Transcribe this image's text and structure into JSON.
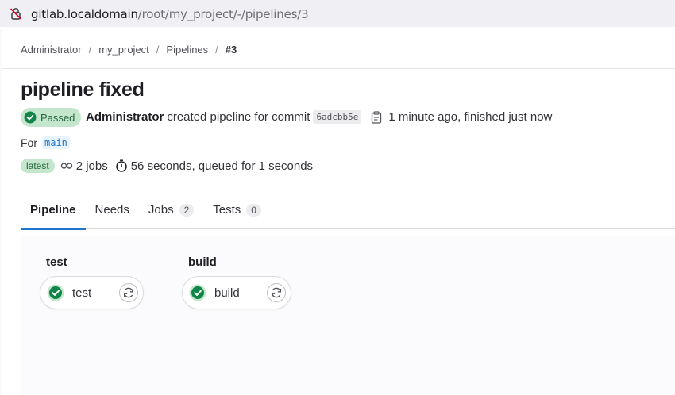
{
  "browser": {
    "url_host": "gitlab.localdomain",
    "url_path": "/root/my_project/-/pipelines/3",
    "lock_icon": "insecure-lock-icon"
  },
  "breadcrumb": [
    "Administrator",
    "my_project",
    "Pipelines",
    "#3"
  ],
  "pipeline": {
    "title": "pipeline fixed",
    "status": "Passed",
    "user": "Administrator",
    "action_text": "created pipeline for commit",
    "commit": "6adcbb5e",
    "time_text": "1 minute ago, finished just now",
    "for_label": "For",
    "branch": "main",
    "latest_badge": "latest",
    "jobs_text": "2 jobs",
    "duration_text": "56 seconds, queued for 1 seconds"
  },
  "tabs": [
    {
      "label": "Pipeline",
      "active": true
    },
    {
      "label": "Needs"
    },
    {
      "label": "Jobs",
      "count": "2"
    },
    {
      "label": "Tests",
      "count": "0"
    }
  ],
  "stages": [
    {
      "name": "test",
      "job": "test",
      "status": "success"
    },
    {
      "name": "build",
      "job": "build",
      "status": "success"
    }
  ],
  "colors": {
    "success": "#108548",
    "success_bg": "#c3e6cd",
    "link": "#1f75cb"
  }
}
